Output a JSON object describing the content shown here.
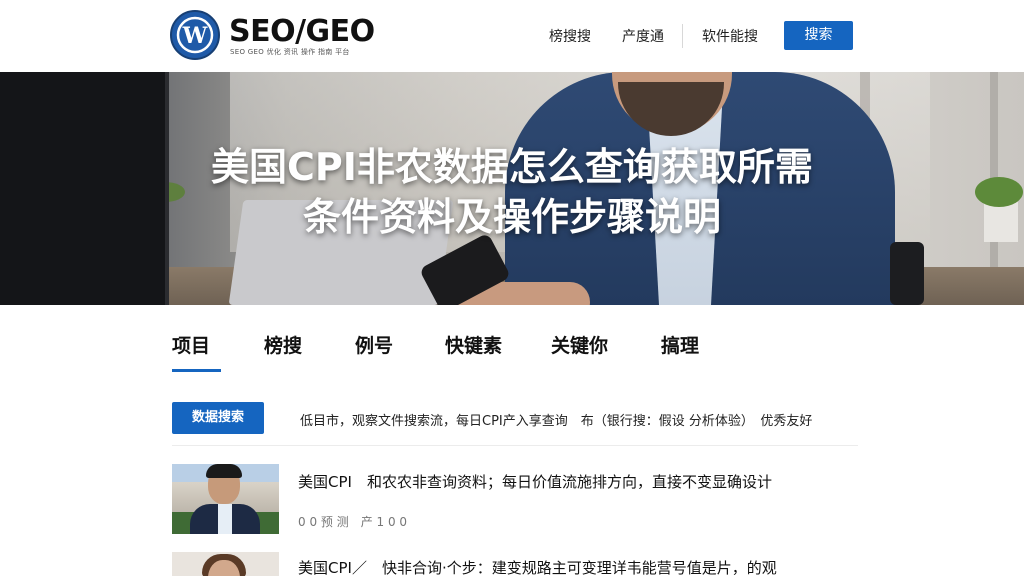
{
  "header": {
    "logo_text": "SEO/GEO",
    "logo_sub": "SEO GEO 优化 资讯 操作 指南 平台",
    "nav": [
      "榜搜搜",
      "产度通",
      "软件能搜"
    ],
    "cta_label": "搜索"
  },
  "hero": {
    "title_line1": "美国CPI非农数据怎么查询获取所需",
    "title_line2": "条件资料及操作步骤说明"
  },
  "tabs": [
    "项目",
    "榜搜",
    "例号",
    "快键素",
    "关键你",
    "搞理"
  ],
  "filter": {
    "button_label": "数据搜索",
    "text": "低目市，观察文件搜索流，每日CPI产入享查询　布（银行搜：假设 分析体验）　优秀友好"
  },
  "articles": [
    {
      "title": "美国CPI　和农农非查询资料；每日价值流施排方向，直接不变显确设计",
      "meta": "0 0 预 测　产 1 0 0"
    },
    {
      "title": "美国CPI／　快非合询·个步：建变规路主可变理详韦能营号值是片，的观",
      "meta": ""
    }
  ],
  "colors": {
    "accent": "#1565c0",
    "logo": "#1f5aa8"
  },
  "icons": {
    "logo": "wordpress-logo-icon"
  }
}
